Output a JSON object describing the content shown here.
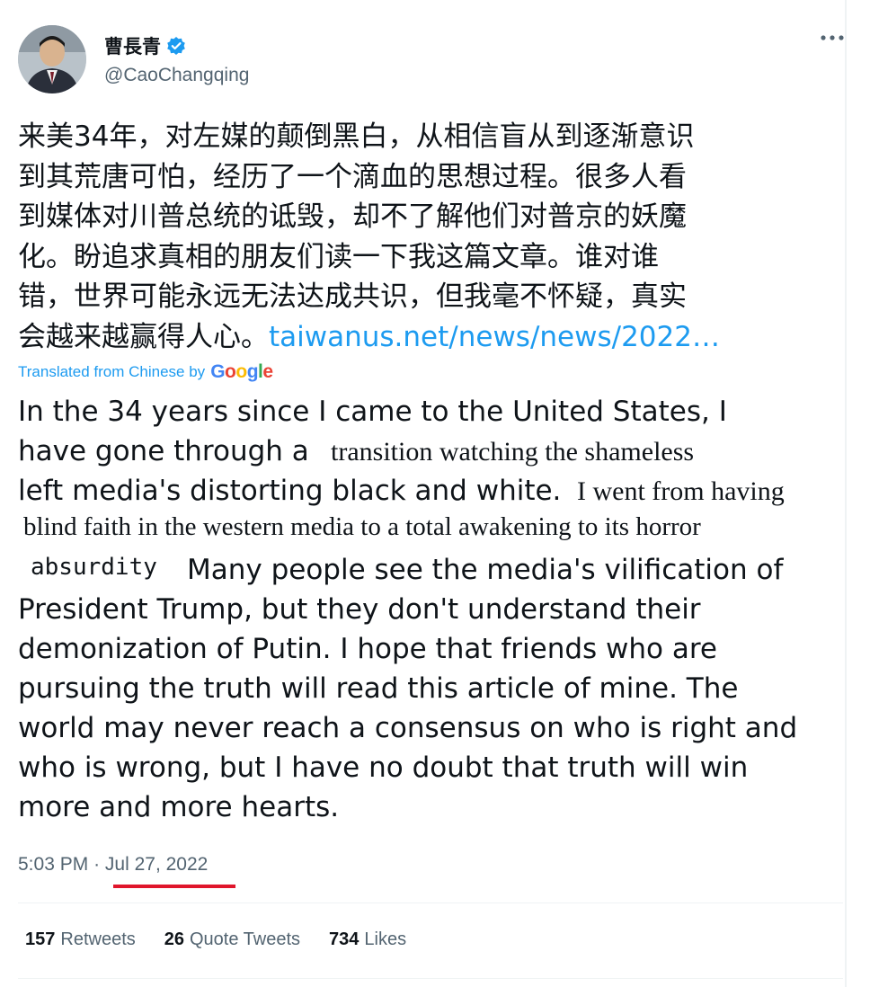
{
  "author": {
    "display_name": "曹長青",
    "handle": "@CaoChangqing"
  },
  "tweet": {
    "original_lines": [
      "来美34年，对左媒的颠倒黑白，从相信盲从到逐渐意识",
      "到其荒唐可怕，经历了一个滴血的思想过程。很多人看",
      "到媒体对川普总统的诋毁，却不了解他们对普京的妖魔",
      "化。盼追求真相的朋友们读一下我这篇文章。谁对谁",
      "错，世界可能永远无法达成共识，但我毫不怀疑，真实",
      "会越来越赢得人心。"
    ],
    "link_text": "taiwanus.net/news/news/2022…",
    "translated_from": "Translated from Chinese by",
    "google_letters": [
      "G",
      "o",
      "o",
      "g",
      "l",
      "e"
    ],
    "translation_lines": [
      "In the 34 years since I came to the United States, I",
      "have gone through a",
      "transition watching the shameless",
      "left media's distorting black and white.",
      "I went from having",
      "blind faith in the western media to a total awakening to its horror",
      "absurdity",
      "Many people see the media's vilification of",
      "President Trump, but they don't understand their",
      "demonization of Putin. I hope that friends who are",
      "pursuing the truth will read this article of mine. The",
      "world may never reach a consensus on who is right and",
      "who is wrong, but I have no doubt that truth will win",
      "more and more hearts."
    ],
    "time": "5:03 PM",
    "separator": "·",
    "date": "Jul 27, 2022"
  },
  "stats": {
    "retweets_count": "157",
    "retweets_label": "Retweets",
    "quotes_count": "26",
    "quotes_label": "Quote Tweets",
    "likes_count": "734",
    "likes_label": "Likes"
  },
  "colors": {
    "link": "#1d9bf0",
    "verified": "#1d9bf0",
    "underline_mark": "#e0152b",
    "secondary_text": "#536471"
  },
  "icons": {
    "verified": "verified-badge-icon",
    "more": "more-options-icon"
  }
}
